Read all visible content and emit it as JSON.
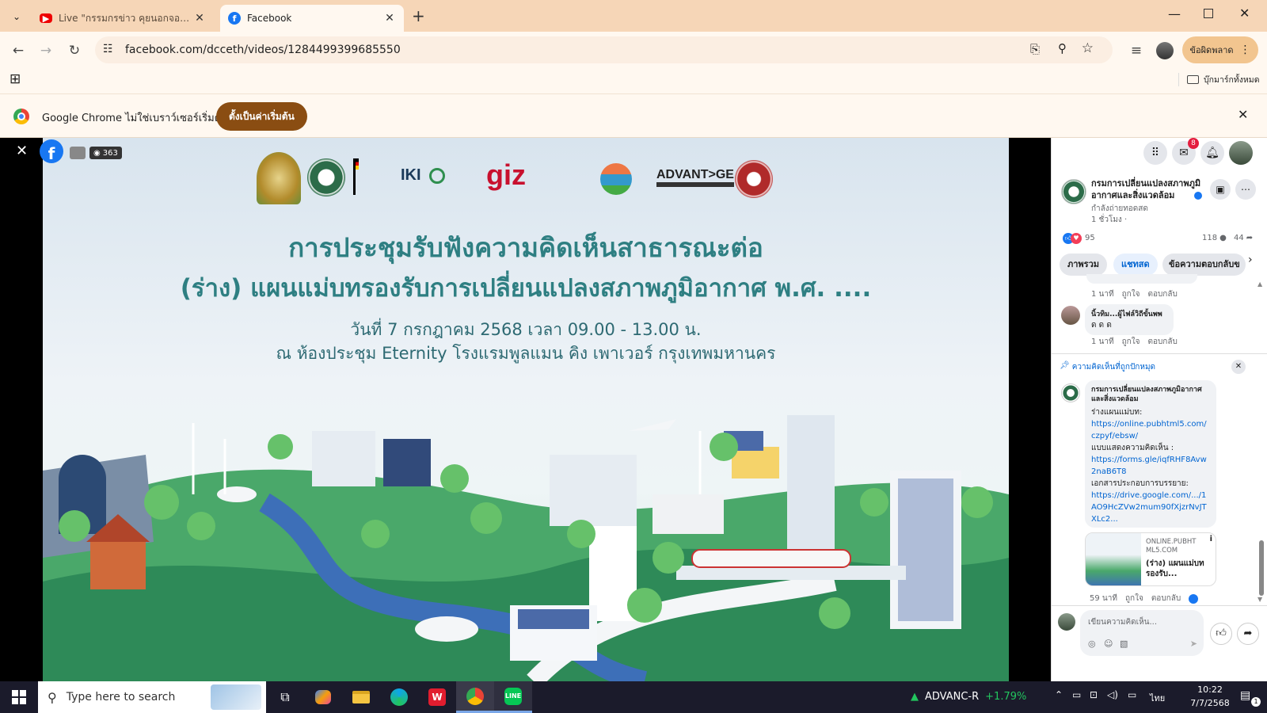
{
  "browser": {
    "tabs": [
      {
        "title": "Live \"กรรมกรข่าว คุยนอกจอ\" 7 กร",
        "favicon": "youtube-icon",
        "active": false
      },
      {
        "title": "Facebook",
        "favicon": "facebook-icon",
        "active": true
      }
    ],
    "url": "facebook.com/dcceth/videos/1284499399685550",
    "error_button": "ข้อผิดพลาด",
    "bookmarks_label": "บุ๊กมาร์กทั้งหมด",
    "infobar": {
      "message": "Google Chrome ไม่ใช่เบราว์เซอร์เริ่มต้น",
      "button": "ตั้งเป็นค่าเริ่มต้น"
    }
  },
  "viewer": {
    "view_count": "363",
    "slide": {
      "title_line1": "การประชุมรับฟังความคิดเห็นสาธารณะต่อ",
      "title_line2": "(ร่าง) แผนแม่บทรองรับการเปลี่ยนแปลงสภาพภูมิอากาศ พ.ศ. ....",
      "date_line": "วันที่ 7 กรกฎาคม 2568 เวลา 09.00 - 13.00 น.",
      "venue_line": "ณ ห้องประชุม Eternity โรงแรมพูลแมน คิง เพาเวอร์ กรุงเทพมหานคร",
      "logo_iki": "IKI",
      "logo_giz": "giz",
      "logo_advantage": "ADVANT>GE"
    }
  },
  "sidebar": {
    "messenger_badge": "8",
    "page_name": "กรมการเปลี่ยนแปลงสภาพภูมิอากาศและสิ่งแวดล้อม",
    "live_status": "กำลังถ่ายทอดสด",
    "time": "1 ชั่วโมง ·",
    "reactions": "95",
    "comments_count": "118",
    "shares_count": "44",
    "tabs": [
      "ภาพรวม",
      "แชทสด",
      "ข้อความตอบกลับข"
    ],
    "comments": [
      {
        "time": "1 นาที",
        "like": "ถูกใจ",
        "reply": "ตอบกลับ"
      },
      {
        "name": "นิ้วทิม...ผู้ไฟล์วิถีขั้นพพ",
        "text": "ด ด ด",
        "time": "1 นาที",
        "like": "ถูกใจ",
        "reply": "ตอบกลับ"
      }
    ],
    "pinned_label": "ความคิดเห็นที่ถูกปักหมุด",
    "pinned": {
      "name": "กรมการเปลี่ยนแปลงสภาพภูมิอากาศและสิ่งแวดล้อม",
      "l1": "ร่างแผนแม่บท:",
      "link1": "https://online.pubhtml5.com/czpyf/ebsw/",
      "l2": "แบบแสดงความคิดเห็น :",
      "link2": "https://forms.gle/iqfRHF8Avw2naB6T8",
      "l3": "เอกสารประกอบการบรรยาย:",
      "link3": "https://drive.google.com/.../1AO9HcZVw2mum90fXjzrNvJTXLc2...",
      "preview_domain": "ONLINE.PUBHTML5.COM",
      "preview_title": "(ร่าง) แผนแม่บทรองรับ...",
      "time": "59 นาที",
      "like": "ถูกใจ",
      "reply": "ตอบกลับ"
    },
    "comment_placeholder": "เขียนความคิดเห็น..."
  },
  "taskbar": {
    "search_placeholder": "Type here to search",
    "stock_name": "ADVANC-R",
    "stock_change": "+1.79%",
    "lang": "ไทย",
    "time": "10:22",
    "date": "7/7/2568",
    "notif_count": "1"
  }
}
